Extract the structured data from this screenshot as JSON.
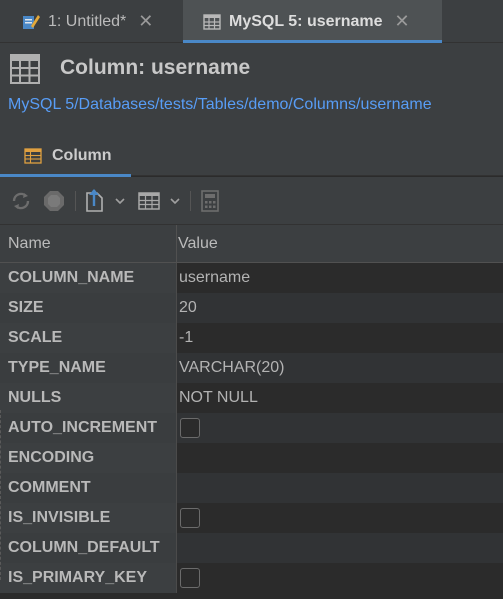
{
  "tabs": [
    {
      "label": "1: Untitled*",
      "close": "✕",
      "active": false,
      "icon": "sql-console-pencil-icon"
    },
    {
      "label": "MySQL 5: username",
      "close": "✕",
      "active": true,
      "icon": "table-grid-icon"
    }
  ],
  "header": {
    "title": "Column: username",
    "path": "MySQL 5/Databases/tests/Tables/demo/Columns/username",
    "icon": "table-grid-icon"
  },
  "subtab": {
    "label": "Column",
    "icon": "table-grid-icon"
  },
  "toolbar": {
    "icons": [
      "refresh-icon",
      "stop-icon",
      "export-icon",
      "dropdown-chevron-icon",
      "grid-view-icon",
      "dropdown-chevron-icon",
      "calculator-icon"
    ]
  },
  "table": {
    "headers": {
      "name": "Name",
      "value": "Value"
    },
    "rows": [
      {
        "name": "COLUMN_NAME",
        "value": "username",
        "type": "text"
      },
      {
        "name": "SIZE",
        "value": "20",
        "type": "text"
      },
      {
        "name": "SCALE",
        "value": "-1",
        "type": "text"
      },
      {
        "name": "TYPE_NAME",
        "value": "VARCHAR(20)",
        "type": "text"
      },
      {
        "name": "NULLS",
        "value": "NOT NULL",
        "type": "text"
      },
      {
        "name": "AUTO_INCREMENT",
        "value": "",
        "type": "checkbox",
        "checked": false
      },
      {
        "name": "ENCODING",
        "value": "",
        "type": "text"
      },
      {
        "name": "COMMENT",
        "value": "",
        "type": "text"
      },
      {
        "name": "IS_INVISIBLE",
        "value": "",
        "type": "checkbox",
        "checked": false
      },
      {
        "name": "COLUMN_DEFAULT",
        "value": "",
        "type": "text"
      },
      {
        "name": "IS_PRIMARY_KEY",
        "value": "",
        "type": "checkbox",
        "checked": false
      }
    ]
  },
  "colors": {
    "accent": "#4a88c7",
    "link": "#589df6",
    "background": "#2b2b2b",
    "panel": "#3c3f41"
  }
}
